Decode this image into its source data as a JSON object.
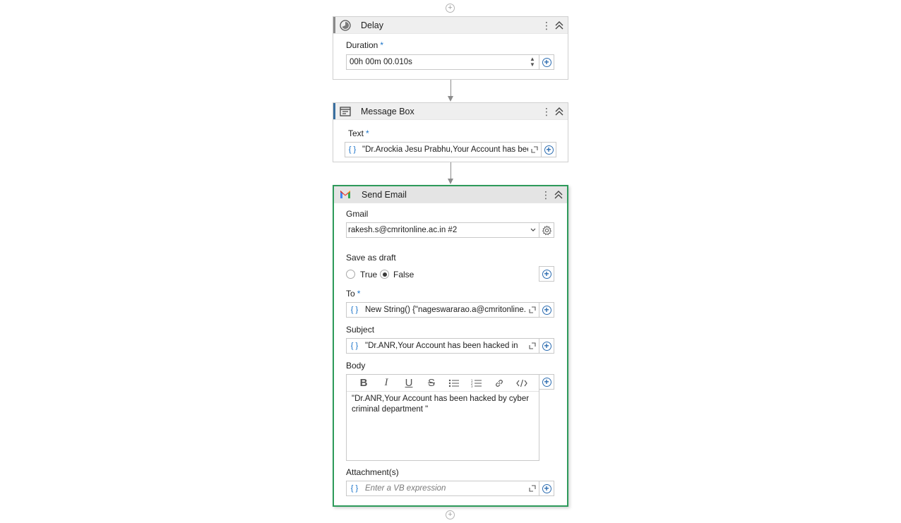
{
  "delay": {
    "title": "Delay",
    "duration_label": "Duration",
    "required_mark": "*",
    "duration_value": "00h 00m 00.010s"
  },
  "message_box": {
    "title": "Message Box",
    "text_label": "Text",
    "required_mark": "*",
    "text_value": "\"Dr.Arockia Jesu Prabhu,Your Account has been hacked by cyber criminal department \""
  },
  "send_email": {
    "title": "Send Email",
    "gmail_label": "Gmail",
    "gmail_account": "rakesh.s@cmritonline.ac.in #2",
    "save_as_draft_label": "Save as draft",
    "radio_true": "True",
    "radio_false": "False",
    "save_as_draft_selected": "False",
    "to_label": "To",
    "required_mark": "*",
    "to_value": "New String() {\"nageswararao.a@cmritonline.ac.in\"}",
    "subject_label": "Subject",
    "subject_value": "\"Dr.ANR,Your Account has been hacked in",
    "body_label": "Body",
    "body_value": "\"Dr.ANR,Your Account has been hacked by cyber criminal department \"",
    "attachments_label": "Attachment(s)",
    "attachments_placeholder": "Enter a VB expression",
    "accent_color": "#2d9a5a"
  },
  "icons": {
    "braces": "{ }",
    "add": "+",
    "kebab": "⋮"
  }
}
